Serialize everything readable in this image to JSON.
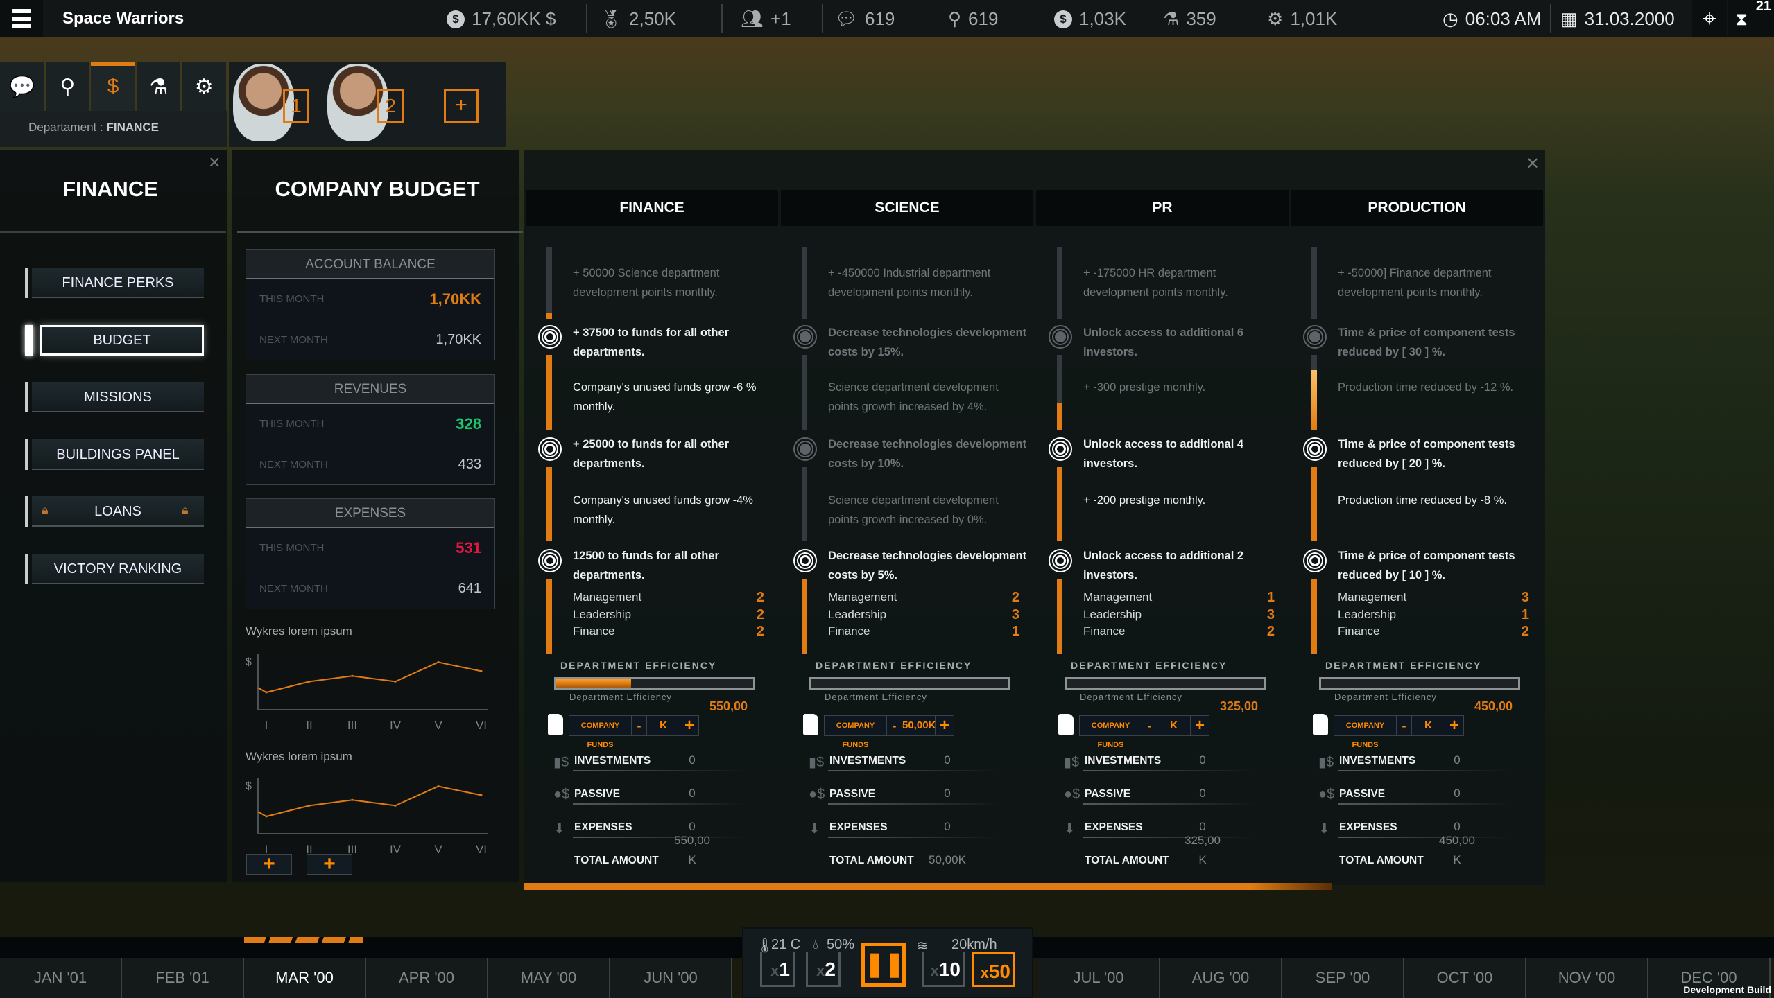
{
  "app": {
    "title": "Space Warriors"
  },
  "topbar": {
    "money": "17,60KK $",
    "prestige": "2,50K",
    "people": "+1",
    "chat": "619",
    "location": "619",
    "coins": "1,03K",
    "science": "359",
    "production": "1,01K",
    "time": "06:03 AM",
    "date": "31.03.2000",
    "notifications": "21"
  },
  "dept_tabs": {
    "items": [
      {
        "icon": "chat-icon",
        "glyph": "💬"
      },
      {
        "icon": "location-pin-icon",
        "glyph": "⚲"
      },
      {
        "icon": "coins-icon",
        "glyph": "$"
      },
      {
        "icon": "flask-icon",
        "glyph": "⚗"
      },
      {
        "icon": "gear-icon",
        "glyph": "⚙"
      }
    ],
    "active": 2,
    "label_prefix": "Departament :",
    "label_value": "FINANCE"
  },
  "managers": [
    {
      "slot": "1"
    },
    {
      "slot": "2"
    }
  ],
  "add_manager": "+",
  "left_panel": {
    "title": "FINANCE",
    "items": [
      "FINANCE PERKS",
      "BUDGET",
      "MISSIONS",
      "BUILDINGS PANEL",
      "LOANS",
      "VICTORY RANKING"
    ],
    "active": 1,
    "locked": 4
  },
  "budget": {
    "title": "COMPANY BUDGET",
    "sections": [
      {
        "title": "ACCOUNT BALANCE",
        "this_label": "THIS MONTH",
        "this_value": "1,70KK",
        "this_color": "#e07c13",
        "next_label": "NEXT MONTH",
        "next_value": "1,70KK"
      },
      {
        "title": "REVENUES",
        "this_label": "THIS MONTH",
        "this_value": "328",
        "this_color": "#1fc46a",
        "next_label": "NEXT MONTH",
        "next_value": "433"
      },
      {
        "title": "EXPENSES",
        "this_label": "THIS MONTH",
        "this_value": "531",
        "this_color": "#e0173f",
        "next_label": "NEXT MONTH",
        "next_value": "641"
      }
    ],
    "add_buttons": [
      "+",
      "+"
    ]
  },
  "chart_data": [
    {
      "type": "line",
      "title": "Wykres lorem ipsum",
      "ylabel": "$",
      "categories": [
        "I",
        "II",
        "III",
        "IV",
        "V",
        "VI"
      ],
      "start_value": 35,
      "values": [
        25,
        48,
        60,
        48,
        89,
        70
      ],
      "ylim": [
        0,
        100
      ],
      "color": "#e07c13"
    },
    {
      "type": "line",
      "title": "Wykres lorem ipsum",
      "ylabel": "$",
      "categories": [
        "I",
        "II",
        "III",
        "IV",
        "V",
        "VI"
      ],
      "start_value": 35,
      "values": [
        25,
        48,
        60,
        48,
        89,
        70
      ],
      "ylim": [
        0,
        100
      ],
      "color": "#e07c13"
    }
  ],
  "departments": [
    {
      "name": "FINANCE",
      "perks": [
        "+ 50000 Science department development points monthly.",
        "+ 37500 to funds for all other departments.",
        "Company's unused funds grow -6 % monthly.",
        "+ 25000 to funds for all other departments.",
        "Company's unused funds grow -4% monthly.",
        "12500 to funds for all other departments."
      ],
      "perk_active": [
        false,
        true,
        true,
        true,
        true,
        true
      ],
      "progress": [
        0.08,
        1,
        1,
        1
      ],
      "skills": [
        {
          "label": "Management",
          "value": "2"
        },
        {
          "label": "Leadership",
          "value": "2"
        },
        {
          "label": "Finance",
          "value": "2"
        }
      ],
      "efficiency_label": "DEPARTMENT EFFICIENCY",
      "efficiency_sub": "Department Efficiency",
      "efficiency": 0.38,
      "efficiency_value": "550,00",
      "funds_label": "COMPANY FUNDS",
      "funds_minus": "-",
      "funds_value": "K",
      "funds_plus": "+",
      "investments_label": "INVESTMENTS",
      "investments": "0",
      "passive_label": "PASSIVE",
      "passive": "0",
      "expenses_label": "EXPENSES",
      "expenses": "0",
      "expenses_sub": "550,00",
      "total_label": "TOTAL AMOUNT",
      "total": "K"
    },
    {
      "name": "SCIENCE",
      "perks": [
        "+ -450000 Industrial department development points monthly.",
        "Decrease technologies development costs by 15%.",
        "Science department development points growth increased by 4%.",
        "Decrease technologies development costs by 10%.",
        "Science department development points growth increased by 0%.",
        "Decrease technologies development costs by 5%."
      ],
      "perk_active": [
        false,
        false,
        false,
        false,
        false,
        true
      ],
      "progress": [
        0,
        0,
        0,
        1
      ],
      "skills": [
        {
          "label": "Management",
          "value": "2"
        },
        {
          "label": "Leadership",
          "value": "3"
        },
        {
          "label": "Finance",
          "value": "1"
        }
      ],
      "efficiency_label": "DEPARTMENT EFFICIENCY",
      "efficiency_sub": "Department Efficiency",
      "efficiency": 0,
      "efficiency_value": "",
      "funds_label": "COMPANY FUNDS",
      "funds_minus": "-",
      "funds_value": "50,00K",
      "funds_plus": "+",
      "investments_label": "INVESTMENTS",
      "investments": "0",
      "passive_label": "PASSIVE",
      "passive": "0",
      "expenses_label": "EXPENSES",
      "expenses": "0",
      "expenses_sub": "",
      "total_label": "TOTAL AMOUNT",
      "total": "50,00K"
    },
    {
      "name": "PR",
      "perks": [
        "+ -175000 HR department development points monthly.",
        "Unlock access to additional  6 investors.",
        "+ -300 prestige monthly.",
        "Unlock access to additional 4 investors.",
        "+ -200 prestige monthly.",
        "Unlock access to additional 2 investors."
      ],
      "perk_active": [
        false,
        false,
        false,
        true,
        true,
        true
      ],
      "progress": [
        0,
        0.35,
        1,
        1
      ],
      "skills": [
        {
          "label": "Management",
          "value": "1"
        },
        {
          "label": "Leadership",
          "value": "3"
        },
        {
          "label": "Finance",
          "value": "2"
        }
      ],
      "efficiency_label": "DEPARTMENT EFFICIENCY",
      "efficiency_sub": "Department Efficiency",
      "efficiency": 0,
      "efficiency_value": "325,00",
      "funds_label": "COMPANY FUNDS",
      "funds_minus": "-",
      "funds_value": "K",
      "funds_plus": "+",
      "investments_label": "INVESTMENTS",
      "investments": "0",
      "passive_label": "PASSIVE",
      "passive": "0",
      "expenses_label": "EXPENSES",
      "expenses": "0",
      "expenses_sub": "325,00",
      "total_label": "TOTAL AMOUNT",
      "total": "K"
    },
    {
      "name": "PRODUCTION",
      "perks": [
        "+ -50000] Finance department development points monthly.",
        "Time & price of component tests reduced by [ 30 ] %.",
        "Production time reduced by -12 %.",
        "Time & price of component tests reduced by [ 20 ] %.",
        "Production time reduced by -8 %.",
        "Time & price of component tests reduced by [ 10 ] %."
      ],
      "perk_active": [
        false,
        false,
        false,
        true,
        true,
        true
      ],
      "progress": [
        0,
        0.8,
        1,
        1
      ],
      "skills": [
        {
          "label": "Management",
          "value": "3"
        },
        {
          "label": "Leadership",
          "value": "1"
        },
        {
          "label": "Finance",
          "value": "2"
        }
      ],
      "efficiency_label": "DEPARTMENT EFFICIENCY",
      "efficiency_sub": "Department Efficiency",
      "efficiency": 0,
      "efficiency_value": "450,00",
      "funds_label": "COMPANY FUNDS",
      "funds_minus": "-",
      "funds_value": "K",
      "funds_plus": "+",
      "investments_label": "INVESTMENTS",
      "investments": "0",
      "passive_label": "PASSIVE",
      "passive": "0",
      "expenses_label": "EXPENSES",
      "expenses": "0",
      "expenses_sub": "450,00",
      "total_label": "TOTAL AMOUNT",
      "total": "K"
    }
  ],
  "timeline": {
    "left": [
      "JAN '01",
      "FEB '01",
      "MAR '00",
      "APR '00",
      "MAY '00",
      "JUN '00"
    ],
    "right": [
      "JUL '00",
      "AUG '00",
      "SEP '00",
      "OCT '00",
      "NOV '00",
      "DEC '00"
    ],
    "active": "MAR '00"
  },
  "controls": {
    "temperature": "21 C",
    "humidity": "50%",
    "wind": "20km/h",
    "speeds": [
      "1",
      "2",
      "10",
      "50"
    ],
    "speed_prefix": "x",
    "active_speed": "50",
    "paused": true
  },
  "footer": {
    "build": "Development Build"
  },
  "colors": {
    "accent": "#e07c13",
    "positive": "#1fc46a",
    "negative": "#e0173f"
  }
}
